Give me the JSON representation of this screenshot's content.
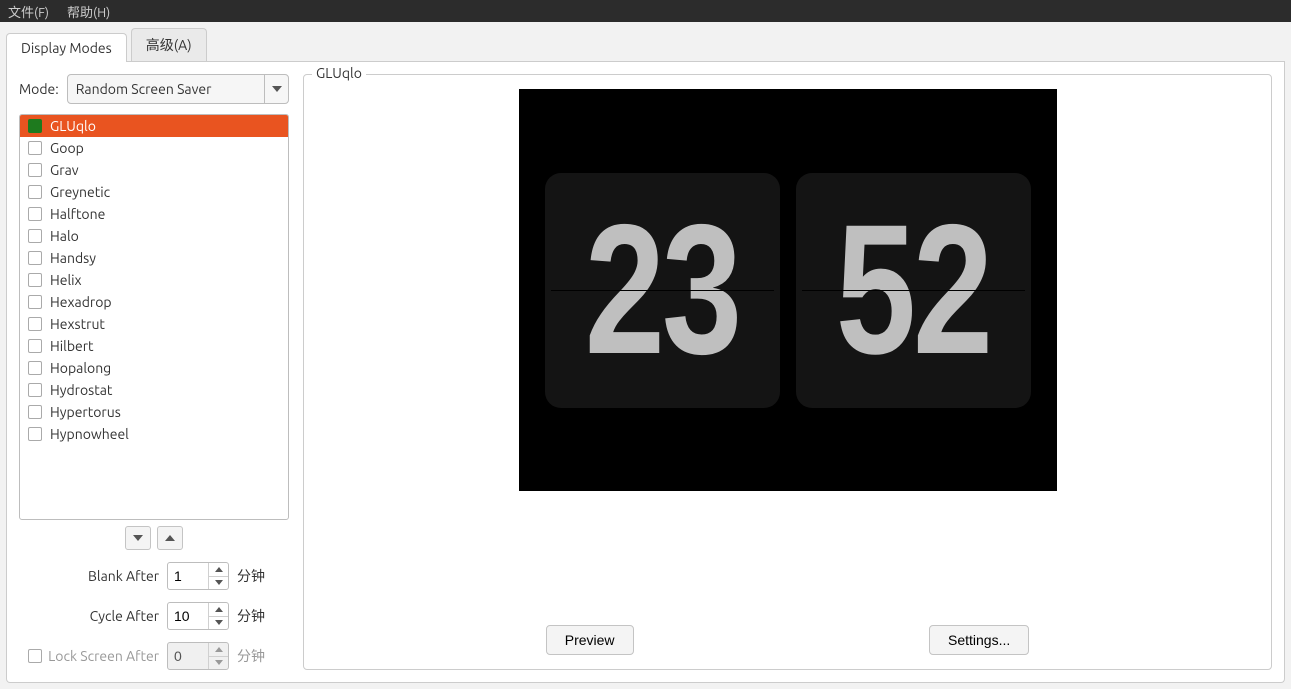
{
  "menubar": {
    "file": "文件(F)",
    "help": "帮助(H)"
  },
  "tabs": {
    "display_modes": "Display Modes",
    "advanced": "高级(A)"
  },
  "left": {
    "mode_label": "Mode:",
    "mode_value": "Random Screen Saver",
    "savers": [
      {
        "name": "GLUqlo",
        "selected": true
      },
      {
        "name": "Goop"
      },
      {
        "name": "Grav"
      },
      {
        "name": "Greynetic"
      },
      {
        "name": "Halftone"
      },
      {
        "name": "Halo"
      },
      {
        "name": "Handsy"
      },
      {
        "name": "Helix"
      },
      {
        "name": "Hexadrop"
      },
      {
        "name": "Hexstrut"
      },
      {
        "name": "Hilbert"
      },
      {
        "name": "Hopalong"
      },
      {
        "name": "Hydrostat"
      },
      {
        "name": "Hypertorus"
      },
      {
        "name": "Hypnowheel"
      }
    ],
    "blank_after_label": "Blank After",
    "blank_after_value": "1",
    "cycle_after_label": "Cycle After",
    "cycle_after_value": "10",
    "lock_after_label": "Lock Screen After",
    "lock_after_value": "0",
    "unit": "分钟"
  },
  "right": {
    "legend": "GLUqlo",
    "clock_hours": "23",
    "clock_minutes": "52",
    "preview_btn": "Preview",
    "settings_btn": "Settings..."
  }
}
